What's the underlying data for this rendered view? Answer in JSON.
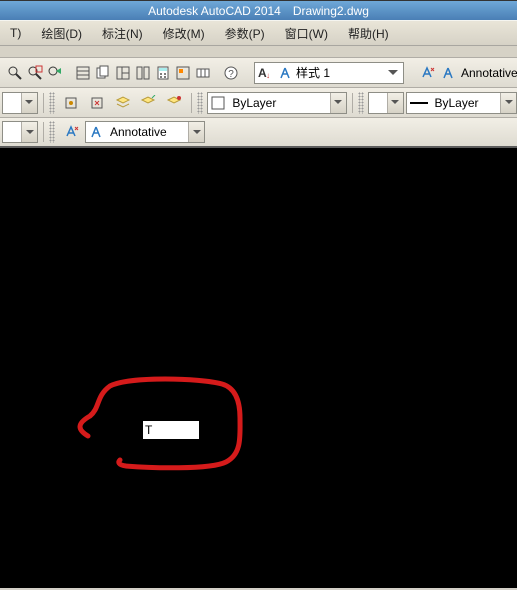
{
  "title": {
    "app": "Autodesk AutoCAD 2014",
    "doc": "Drawing2.dwg"
  },
  "menu": {
    "format_partial": "T)",
    "draw": "绘图(D)",
    "dimension": "标注(N)",
    "modify": "修改(M)",
    "parametric": "参数(P)",
    "window": "窗口(W)",
    "help": "帮助(H)"
  },
  "style": {
    "label": "样式 1",
    "annotative": "Annotative"
  },
  "layer": {
    "bylayer1": "ByLayer",
    "bylayer2": "ByLayer"
  },
  "annot": {
    "label": "Annotative"
  },
  "cmd": {
    "value": "T"
  }
}
